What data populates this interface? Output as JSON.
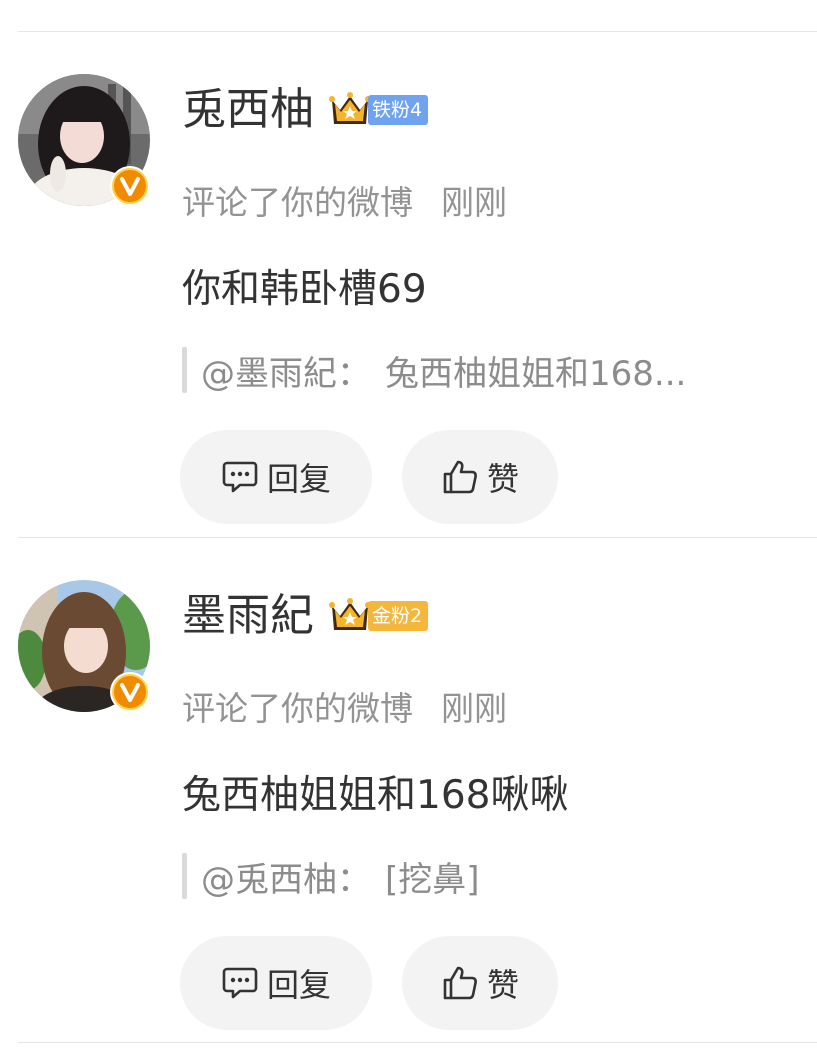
{
  "comments": [
    {
      "username": "兎西柚",
      "fan_badge": {
        "label": "铁粉4",
        "color": "#6fa3f0"
      },
      "action": "评论了你的微博",
      "time": "刚刚",
      "text": "你和韩卧槽69",
      "quote": {
        "author": "@墨雨紀：",
        "text": "兔西柚姐姐和168..."
      },
      "reply_label": "回复",
      "like_label": "赞"
    },
    {
      "username": "墨雨紀",
      "fan_badge": {
        "label": "金粉2",
        "color": "#f5b73b"
      },
      "action": "评论了你的微博",
      "time": "刚刚",
      "text": "兔西柚姐姐和168啾啾",
      "quote": {
        "author": "@兎西柚：",
        "text": "[挖鼻]"
      },
      "reply_label": "回复",
      "like_label": "赞"
    }
  ],
  "icons": {
    "verified": "verified-v-icon",
    "crown": "crown-icon",
    "reply": "comment-bubble-icon",
    "like": "thumbs-up-icon"
  },
  "colors": {
    "verified_orange": "#f28a00",
    "crown_gold": "#f6b42a",
    "crown_dark": "#3d2a10"
  }
}
